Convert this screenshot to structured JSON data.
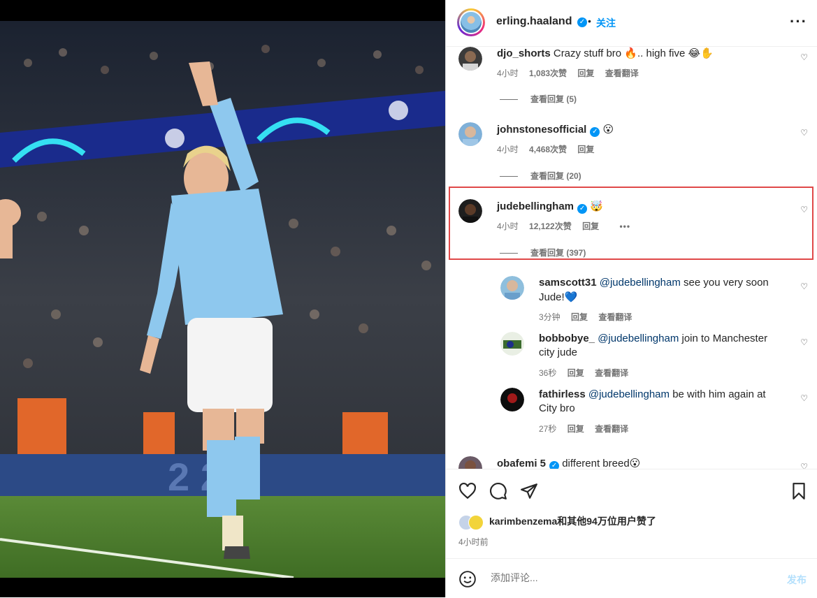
{
  "header": {
    "username": "erling.haaland",
    "dot": "•",
    "follow_label": "关注",
    "more_icon": "more-horizontal-icon"
  },
  "comments": [
    {
      "username": "djo_shorts",
      "text": "Crazy stuff bro",
      "emoji_a": "🔥",
      "text2": ".. high five",
      "emoji_b": "😂✋",
      "time": "4小时",
      "likes": "1,083次赞",
      "reply": "回复",
      "translate": "查看翻译",
      "view_replies": "查看回复 (5)"
    },
    {
      "username": "johnstonesofficial",
      "emoji": "😮",
      "time": "4小时",
      "likes": "4,468次赞",
      "reply": "回复",
      "view_replies": "查看回复 (20)"
    },
    {
      "username": "judebellingham",
      "emoji": "🤯",
      "time": "4小时",
      "likes": "12,122次赞",
      "reply": "回复",
      "more": "•••",
      "view_replies": "查看回复 (397)"
    }
  ],
  "replies": [
    {
      "username": "samscott31",
      "mention": "@judebellingham",
      "text": "see you very soon",
      "text2": "Jude!",
      "emoji": "💙",
      "time": "3分钟",
      "reply": "回复",
      "translate": "查看翻译"
    },
    {
      "username": "bobbobye_",
      "mention": "@judebellingham",
      "text": "join to Manchester",
      "text2": "city jude",
      "time": "36秒",
      "reply": "回复",
      "translate": "查看翻译"
    },
    {
      "username": "fathirless",
      "mention": "@judebellingham",
      "text": "be with him again at",
      "text2": "City bro",
      "time": "27秒",
      "reply": "回复",
      "translate": "查看翻译"
    }
  ],
  "partial_comment": {
    "username": "obafemi 5",
    "text": "different breed",
    "emoji": "😮"
  },
  "actions": {
    "likes_text": "karimbenzema和其他94万位用户赞了",
    "post_time": "4小时前"
  },
  "composer": {
    "placeholder": "添加评论...",
    "publish_label": "发布"
  },
  "colors": {
    "accent": "#0095f6",
    "highlight": "#e04848",
    "muted": "#737373",
    "city_blue": "#8ec8ee"
  },
  "icons": [
    "verified-badge-icon",
    "heart-icon",
    "comment-icon",
    "share-icon",
    "bookmark-icon",
    "emoji-icon"
  ]
}
